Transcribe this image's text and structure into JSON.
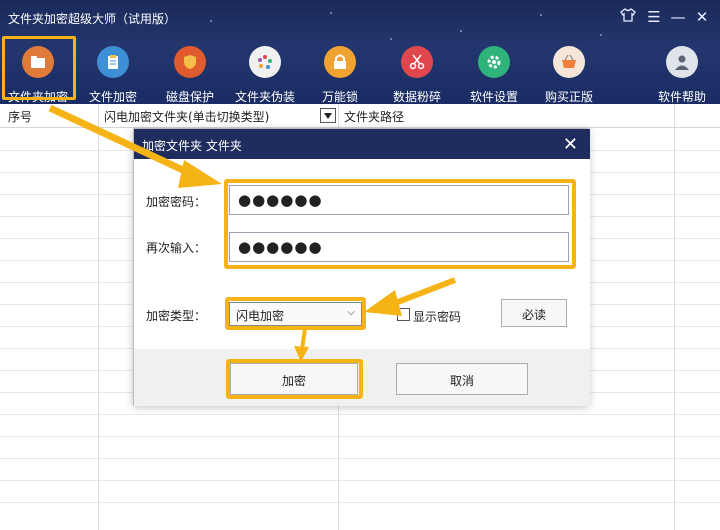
{
  "app": {
    "title": "文件夹加密超级大师（试用版）"
  },
  "window_controls": {
    "skin": "衣",
    "menu": "☰",
    "minimize": "—",
    "close": "✕"
  },
  "toolbar": {
    "items": [
      {
        "label": "文件夹加密",
        "icon": "folder-lock-icon",
        "color": "#e07b39"
      },
      {
        "label": "文件加密",
        "icon": "clipboard-icon",
        "color": "#3d8fd6"
      },
      {
        "label": "磁盘保护",
        "icon": "shield-icon",
        "color": "#e05b2e"
      },
      {
        "label": "文件夹伪装",
        "icon": "palette-icon",
        "color": "#f0f0f0"
      },
      {
        "label": "万能锁",
        "icon": "padlock-icon",
        "color": "#f0a330"
      },
      {
        "label": "数据粉碎",
        "icon": "scissors-icon",
        "color": "#e0474c"
      },
      {
        "label": "软件设置",
        "icon": "gear-icon",
        "color": "#2fb37a"
      },
      {
        "label": "购买正版",
        "icon": "basket-icon",
        "color": "#f07f3a"
      },
      {
        "label": "软件帮助",
        "icon": "user-help-icon",
        "color": "#dfe3ea"
      }
    ]
  },
  "table": {
    "headers": [
      "序号",
      "闪电加密文件夹(单击切换类型)",
      "文件夹路径"
    ]
  },
  "dialog": {
    "title": "加密文件夹 文件夹",
    "close": "✕",
    "password_label": "加密密码：",
    "password_value": "●●●●●●",
    "confirm_label": "再次输入：",
    "confirm_value": "●●●●●●",
    "type_label": "加密类型：",
    "type_value": "闪电加密",
    "show_password_label": "显示密码",
    "must_read_label": "必读",
    "encrypt_label": "加密",
    "cancel_label": "取消"
  },
  "colors": {
    "highlight": "#f5b315",
    "header_bg": "#1b2a5a"
  }
}
